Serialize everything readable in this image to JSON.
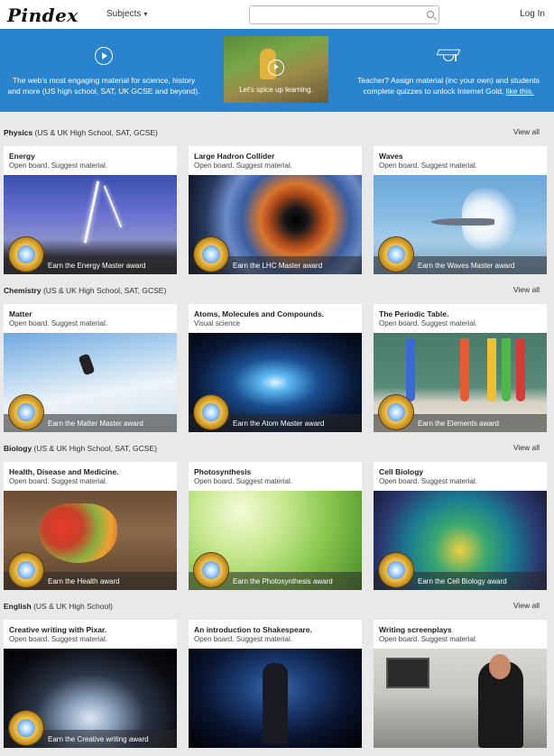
{
  "header": {
    "logo": "Pindex",
    "subjects_label": "Subjects",
    "search_placeholder": "",
    "login_label": "Log In"
  },
  "banner": {
    "left_text": "The web's most engaging material for science, history and more (US high school, SAT, UK GCSE and beyond).",
    "center_text": "Let's spice up learning.",
    "right_text": "Teacher? Assign material (inc your own) and students complete quizzes to unlock Internet Gold,",
    "right_link": "like this."
  },
  "sections": [
    {
      "name": "Physics",
      "qualifier": "(US & UK High School, SAT, GCSE)",
      "view_all": "View all",
      "cards": [
        {
          "title": "Energy",
          "subtitle": "Open board. Suggest material.",
          "award": "Earn the Energy Master award",
          "image": "lightning-city"
        },
        {
          "title": "Large Hadron Collider",
          "subtitle": "Open board. Suggest material.",
          "award": "Earn the LHC Master award",
          "image": "collider-tunnel"
        },
        {
          "title": "Waves",
          "subtitle": "Open board. Suggest material.",
          "award": "Earn the Waves Master award",
          "image": "jet-sonic-boom"
        }
      ]
    },
    {
      "name": "Chemistry",
      "qualifier": "(US & UK High School, SAT, GCSE)",
      "view_all": "View all",
      "cards": [
        {
          "title": "Matter",
          "subtitle": "Open board. Suggest material.",
          "award": "Earn the Matter Master award",
          "image": "skier-snow"
        },
        {
          "title": "Atoms, Molecules and Compounds.",
          "subtitle": "Visual science",
          "award": "Earn the Atom Master award",
          "image": "atom-energy"
        },
        {
          "title": "The Periodic Table.",
          "subtitle": "Open board. Suggest material.",
          "award": "Earn the Elements award",
          "image": "lab-test-tubes"
        }
      ]
    },
    {
      "name": "Biology",
      "qualifier": "(US & UK High School, SAT, GCSE)",
      "view_all": "View all",
      "cards": [
        {
          "title": "Health, Disease and Medicine.",
          "subtitle": "Open board. Suggest material.",
          "award": "Earn the Health award",
          "image": "heart-stethoscope"
        },
        {
          "title": "Photosynthesis",
          "subtitle": "Open board. Suggest material.",
          "award": "Earn the Photosynthesis award",
          "image": "green-leaves"
        },
        {
          "title": "Cell Biology",
          "subtitle": "Open board. Suggest material.",
          "award": "Earn the Cell Biology award",
          "image": "cell-mosaic"
        }
      ]
    },
    {
      "name": "English",
      "qualifier": "(US & UK High School)",
      "view_all": "View all",
      "cards": [
        {
          "title": "Creative writing with Pixar.",
          "subtitle": "Open board. Suggest material.",
          "award": "Earn the Creative writing award",
          "image": "glowing-book"
        },
        {
          "title": "An introduction to Shakespeare.",
          "subtitle": "Open board. Suggest material.",
          "award": "",
          "image": "actors-stage"
        },
        {
          "title": "Writing screenplays",
          "subtitle": "Open board. Suggest material.",
          "award": "",
          "image": "writer-desk"
        }
      ]
    }
  ]
}
